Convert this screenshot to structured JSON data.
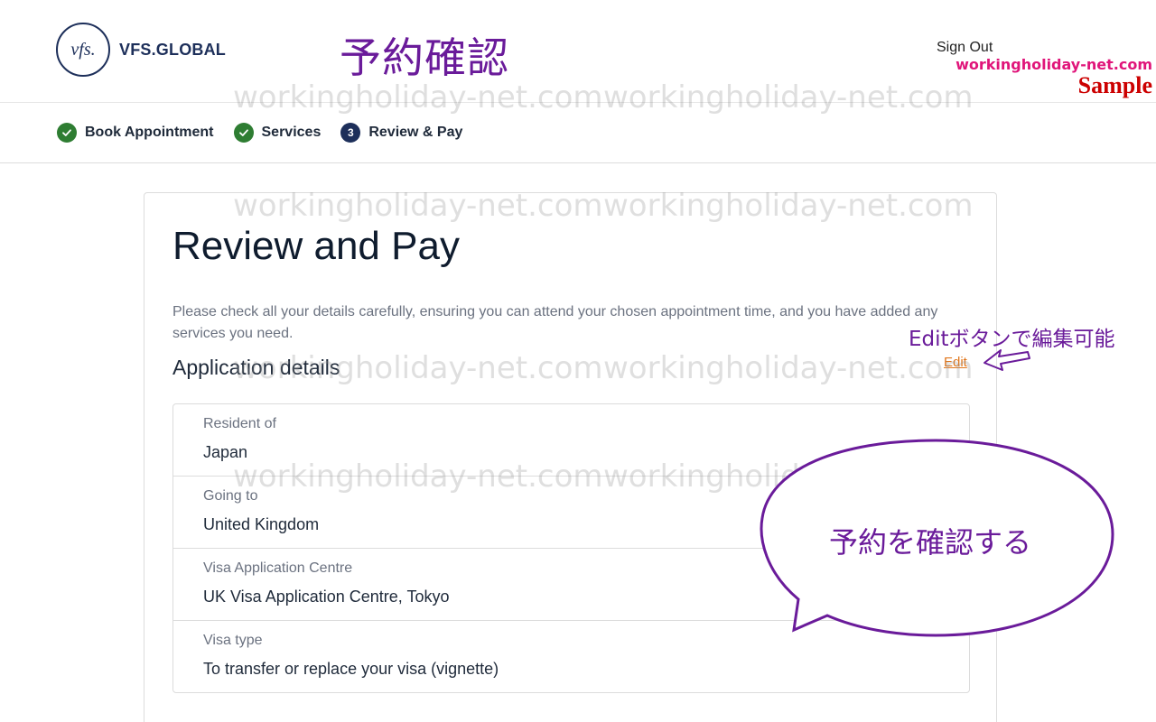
{
  "header": {
    "logo_mark": "vfs.",
    "logo_text": "VFS.GLOBAL",
    "sign_out": "Sign Out"
  },
  "annotation": {
    "title": "予約確認",
    "edit_note": "Editボタンで編集可能",
    "bubble": "予約を確認する",
    "color": "#6a1b9a"
  },
  "watermark": {
    "site": "workingholiday-net.com",
    "sample": "Sample",
    "text": "workingholiday-net.com"
  },
  "stepper": {
    "steps": [
      {
        "label": "Book Appointment",
        "state": "done",
        "icon": "check-icon"
      },
      {
        "label": "Services",
        "state": "done",
        "icon": "check-icon"
      },
      {
        "label": "Review & Pay",
        "state": "current",
        "number": "3"
      }
    ]
  },
  "main": {
    "title": "Review and Pay",
    "description": "Please check all your details carefully, ensuring you can attend your chosen appointment time, and you have added any services you need.",
    "section_title": "Application details",
    "edit": "Edit",
    "details": [
      {
        "label": "Resident of",
        "value": "Japan"
      },
      {
        "label": "Going to",
        "value": "United Kingdom"
      },
      {
        "label": "Visa Application Centre",
        "value": "UK Visa Application Centre, Tokyo"
      },
      {
        "label": "Visa type",
        "value": "To transfer or replace your visa (vignette)"
      }
    ]
  },
  "colors": {
    "check_green": "#2e7d32",
    "navy": "#1d2f5a",
    "edit_orange": "#e0761b",
    "watermark_pink": "#e0157a",
    "sample_red": "#cc0000"
  }
}
